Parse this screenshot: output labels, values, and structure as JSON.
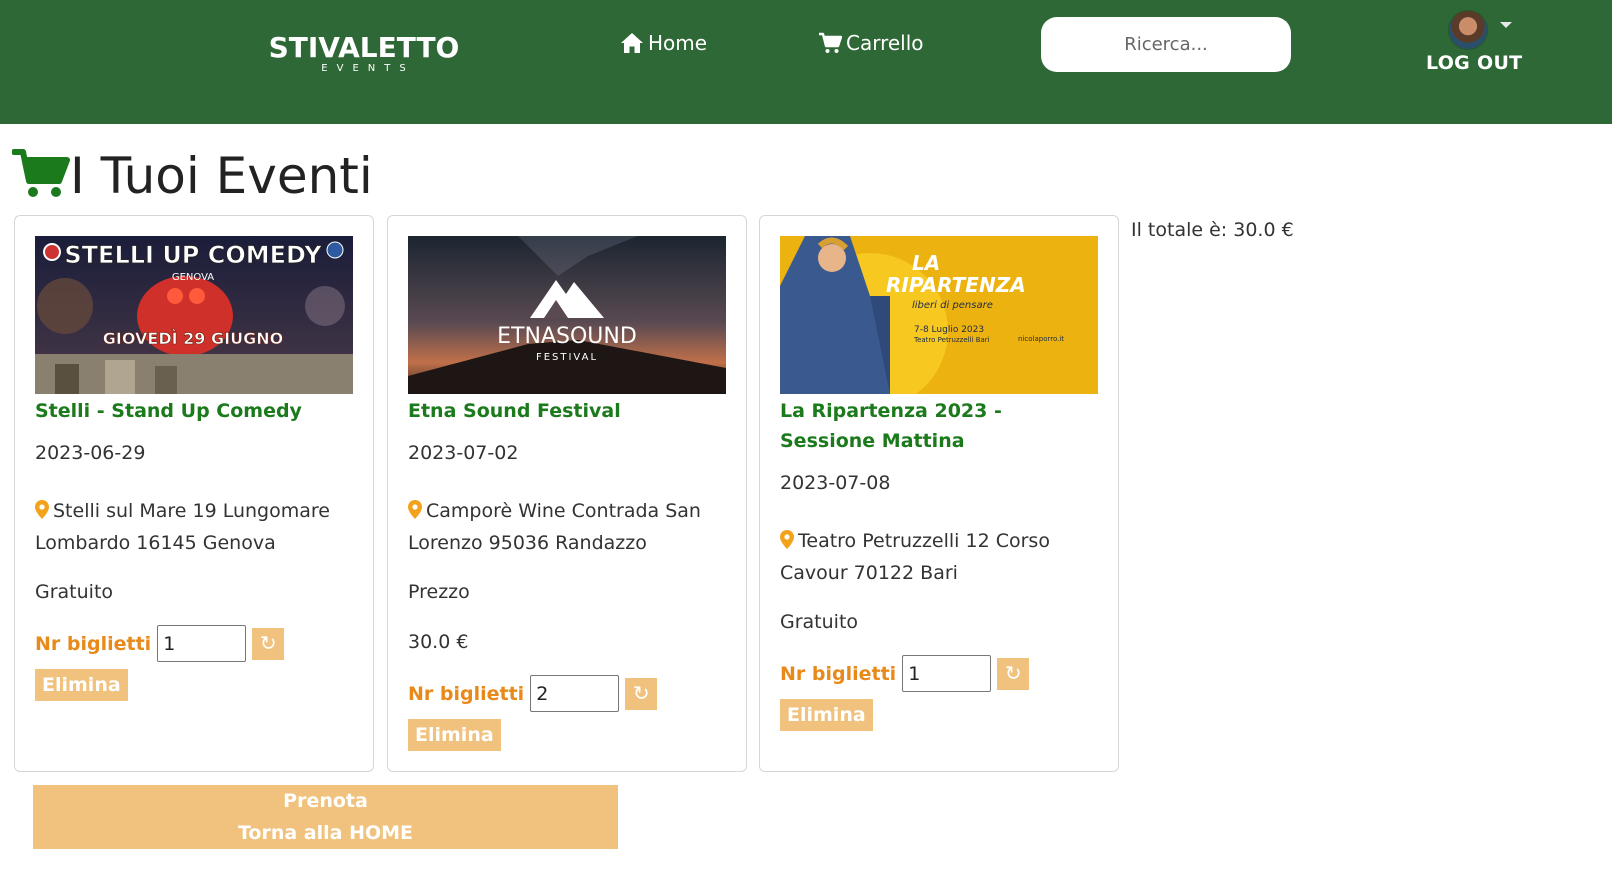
{
  "header": {
    "brand_name": "STIVALETTO",
    "brand_sub": "EVENTS",
    "nav_home": "Home",
    "nav_cart": "Carrello",
    "search_placeholder": "Ricerca...",
    "logout": "LOG OUT"
  },
  "page": {
    "title": "I Tuoi Eventi"
  },
  "cards": [
    {
      "title": "Stelli - Stand Up Comedy",
      "date": "2023-06-29",
      "address": "Stelli sul Mare 19 Lungomare Lombardo 16145 Genova",
      "price": "Gratuito",
      "qty_label": "Nr biglietti",
      "qty": "1",
      "refresh": "↻",
      "delete": "Elimina",
      "image_lines": [
        "STELLI UP COMEDY",
        "GENOVA",
        "GIOVEDÌ 29 GIUGNO"
      ]
    },
    {
      "title": "Etna Sound Festival",
      "date": "2023-07-02",
      "address": "Camporè Wine Contrada San Lorenzo 95036 Randazzo",
      "price": "Prezzo",
      "price_value": "30.0 €",
      "qty_label": "Nr biglietti",
      "qty": "2",
      "refresh": "↻",
      "delete": "Elimina",
      "image_lines": [
        "ETNASOUND",
        "FESTIVAL"
      ]
    },
    {
      "title": "La Ripartenza 2023 - Sessione Mattina",
      "date": "2023-07-08",
      "address": "Teatro Petruzzelli 12 Corso Cavour 70122 Bari",
      "price": "Gratuito",
      "qty_label": "Nr biglietti",
      "qty": "1",
      "refresh": "↻",
      "delete": "Elimina",
      "image_lines": [
        "LA",
        "RIPARTENZA",
        "liberi di pensare",
        "7-8 Luglio 2023",
        "Teatro Petruzzelli Bari",
        "nicolaporro.it"
      ]
    }
  ],
  "summary": {
    "total": "Il totale è: 30.0 €",
    "book": "Prenota",
    "back_home": "Torna alla HOME"
  },
  "colors": {
    "header": "#2e6836",
    "title_green": "#1b7a1b",
    "accent_orange": "#e88a1a",
    "button_peach": "#f0c27d"
  }
}
